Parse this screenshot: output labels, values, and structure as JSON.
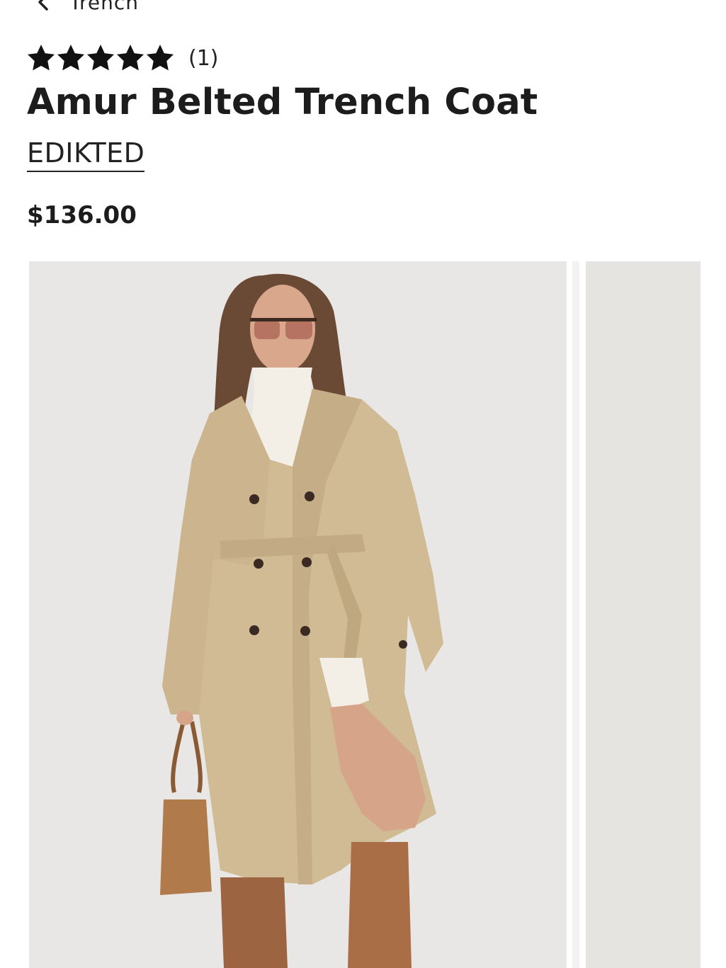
{
  "breadcrumb": {
    "label": "Trench",
    "icon": "chevron-left-icon"
  },
  "rating": {
    "stars": 5,
    "max": 5,
    "count_label": "(1)",
    "icon": "star-icon"
  },
  "product": {
    "title": "Amur Belted Trench Coat",
    "brand": "EDIKTED",
    "price": "$136.00"
  },
  "gallery": {
    "images": [
      {
        "name": "product-image-main",
        "alt": "model wearing trench coat"
      },
      {
        "name": "product-image-next",
        "alt": ""
      }
    ]
  },
  "colors": {
    "text": "#1c1c1c",
    "image_background": "#e8e6e4",
    "coat": "#d1bb95",
    "boots": "#a96e45"
  }
}
